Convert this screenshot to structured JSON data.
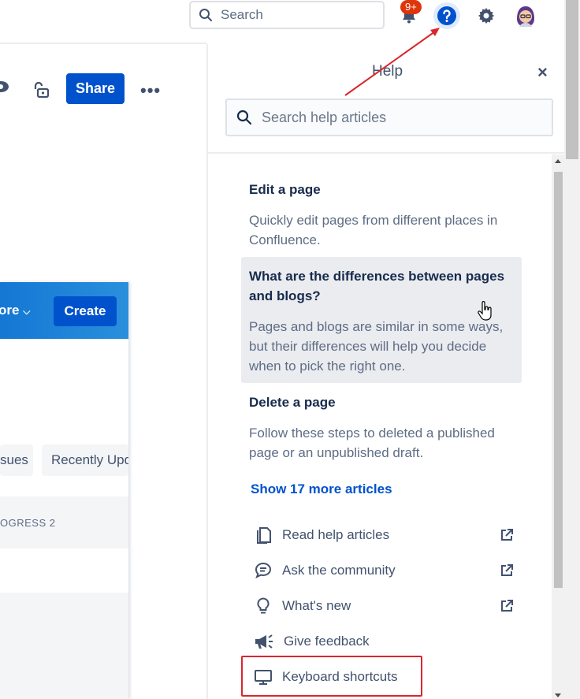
{
  "topbar": {
    "search_placeholder": "Search",
    "notification_count": "9+",
    "icons": [
      "search-icon",
      "notification-icon",
      "help-icon",
      "gear-icon",
      "avatar"
    ]
  },
  "page": {
    "share_label": "Share",
    "more_label": "•••"
  },
  "inner": {
    "more_label": "ore",
    "create_label": "Create",
    "chip1": "sues",
    "chip2": "Recently Upd",
    "progress": "OGRESS  2"
  },
  "help": {
    "title": "Help",
    "close": "×",
    "search_placeholder": "Search help articles",
    "articles": [
      {
        "title": "Edit a page",
        "desc": "Quickly edit pages from different places in Confluence."
      },
      {
        "title": "What are the differences between pages and blogs?",
        "desc": "Pages and blogs are similar in some ways, but their differences will help you decide when to pick the right one."
      },
      {
        "title": "Delete a page",
        "desc": "Follow these steps to deleted a published page or an unpublished draft."
      }
    ],
    "show_more": "Show 17 more articles",
    "links": [
      {
        "label": "Read help articles",
        "icon": "document-icon",
        "external": true
      },
      {
        "label": "Ask the community",
        "icon": "chat-icon",
        "external": true
      },
      {
        "label": "What's new",
        "icon": "lightbulb-icon",
        "external": true
      },
      {
        "label": "Give feedback",
        "icon": "megaphone-icon",
        "external": false
      },
      {
        "label": "Keyboard shortcuts",
        "icon": "monitor-icon",
        "external": false
      }
    ]
  },
  "colors": {
    "brand_blue": "#0052cc",
    "annotation_red": "#d9262d",
    "badge_red": "#de350b"
  }
}
